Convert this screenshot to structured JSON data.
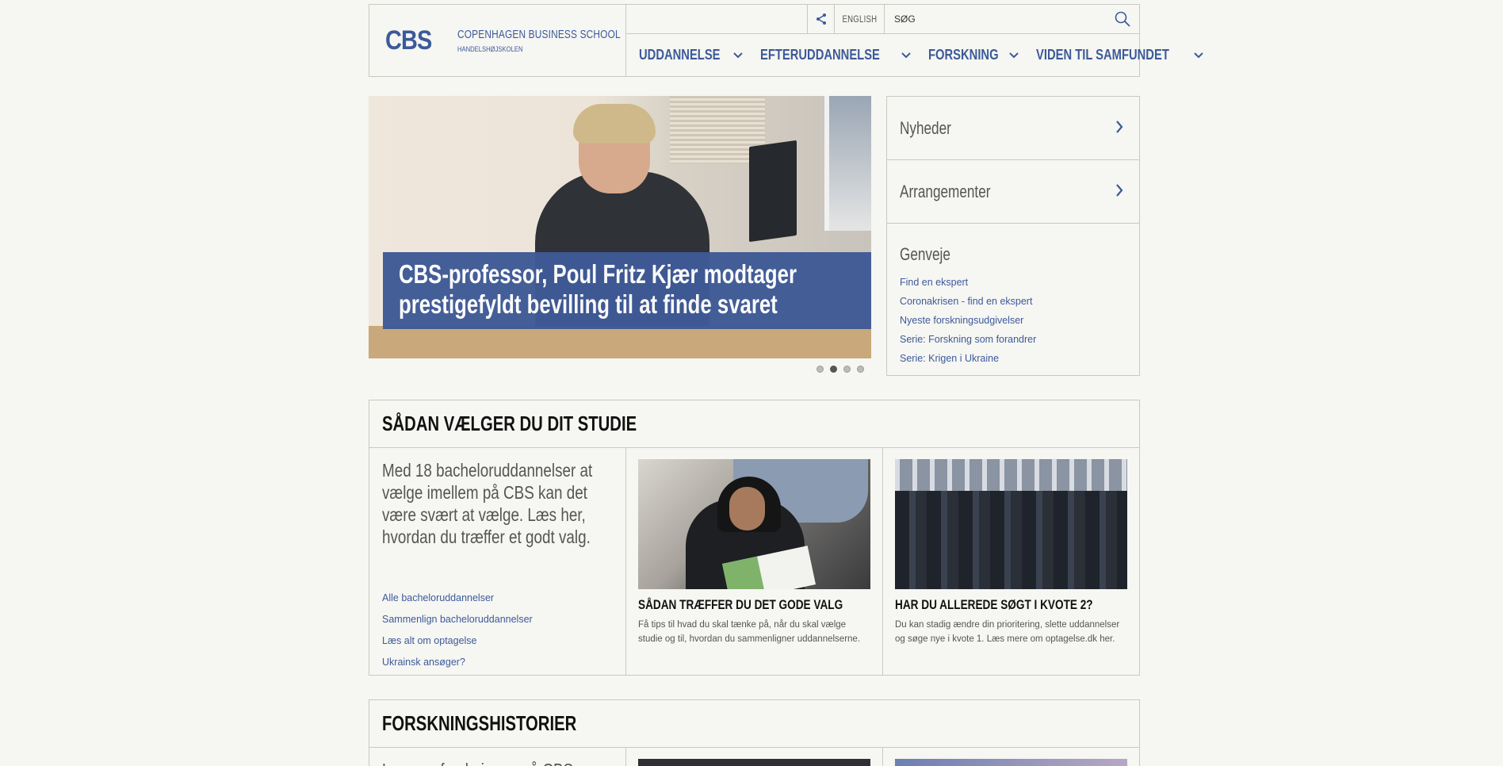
{
  "header": {
    "logo_abbrev": "CBS",
    "logo_name": "COPENHAGEN BUSINESS SCHOOL",
    "logo_sub": "HANDELSHØJSKOLEN",
    "language_link": "ENGLISH",
    "search_placeholder": "SØG",
    "nav": [
      {
        "label": "UDDANNELSE"
      },
      {
        "label": "EFTERUDDANNELSE"
      },
      {
        "label": "FORSKNING"
      },
      {
        "label": "VIDEN TIL SAMFUNDET"
      }
    ]
  },
  "hero": {
    "caption": "CBS-professor, Poul Fritz Kjær modtager prestigefyldt bevilling til at finde svaret",
    "slide_count": 4,
    "active_slide": 2
  },
  "right_panel": {
    "links": [
      {
        "label": "Nyheder"
      },
      {
        "label": "Arrangementer"
      }
    ],
    "shortcuts_title": "Genveje",
    "shortcuts": [
      "Find en ekspert",
      "Coronakrisen - find en ekspert",
      "Nyeste forskningsudgivelser",
      "Serie: Forskning som forandrer",
      "Serie: Krigen i Ukraine"
    ]
  },
  "study_section": {
    "title": "SÅDAN VÆLGER DU DIT STUDIE",
    "intro": "Med 18 bacheloruddannelser at vælge imellem på CBS kan det være svært at vælge. Læs her, hvordan du træffer et godt valg.",
    "links": [
      "Alle bacheloruddannelser",
      "Sammenlign bacheloruddannelser",
      "Læs alt om optagelse",
      "Ukrainsk ansøger?"
    ],
    "cards": [
      {
        "title": "SÅDAN TRÆFFER DU DET GODE VALG",
        "text": "Få tips til hvad du skal tænke på, når du skal vælge studie og til, hvordan du sammenligner uddannelserne."
      },
      {
        "title": "HAR DU ALLEREDE SØGT I KVOTE 2?",
        "text": "Du kan stadig ændre din prioritering, slette uddannelser og søge nye i kvote 1. Læs mere om optagelse.dk her."
      }
    ]
  },
  "research_section": {
    "title": "FORSKNINGSHISTORIER",
    "intro_partial": "Læs om forskningen på CBS"
  },
  "colors": {
    "brand_blue": "#3c5a9a",
    "background": "#f6f6f2",
    "border": "#c9c9c4"
  },
  "icons": {
    "share": "share-icon",
    "search": "search-icon",
    "chevron": "chevron-down-icon",
    "arrow": "chevron-right-icon"
  }
}
